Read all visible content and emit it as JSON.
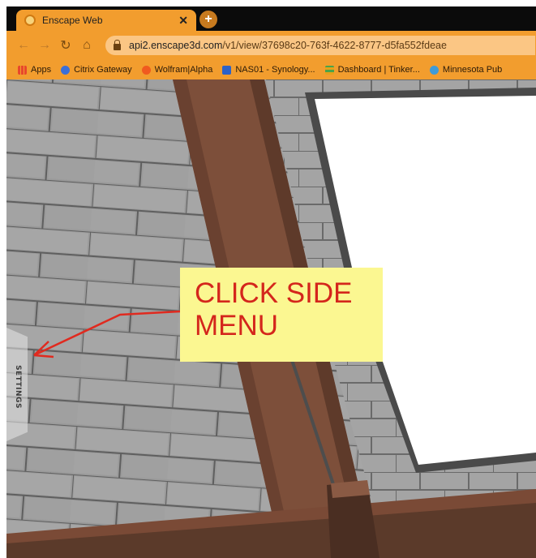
{
  "browser": {
    "tab": {
      "title": "Enscape Web",
      "close_icon": "close-icon"
    },
    "new_tab_icon": "plus-icon",
    "nav": {
      "back_icon": "arrow-left-icon",
      "forward_icon": "arrow-right-icon",
      "reload_icon": "reload-icon",
      "home_icon": "home-icon"
    },
    "address": {
      "host": "api2.enscape3d.com",
      "path": "/v1/view/37698c20-763f-4622-8777-d5fa552fdeae"
    },
    "bookmarks": [
      {
        "label": "Apps",
        "icon": "apps-grid-icon",
        "color": "#e8472c"
      },
      {
        "label": "Citrix Gateway",
        "icon": "citrix-icon",
        "color": "#3b6fd8"
      },
      {
        "label": "Wolfram|Alpha",
        "icon": "wolfram-icon",
        "color": "#f05a1f"
      },
      {
        "label": "NAS01 - Synology...",
        "icon": "synology-icon",
        "color": "#2c62c8"
      },
      {
        "label": "Dashboard | Tinker...",
        "icon": "tinkercad-icon",
        "color": "#e5a21a"
      },
      {
        "label": "Minnesota Pub",
        "icon": "minnesota-icon",
        "color": "#3f9bd8"
      }
    ]
  },
  "app": {
    "side_menu_label": "SETTINGS"
  },
  "annotation": {
    "line1": "CLICK SIDE",
    "line2": "MENU",
    "color": "#d4261c"
  }
}
